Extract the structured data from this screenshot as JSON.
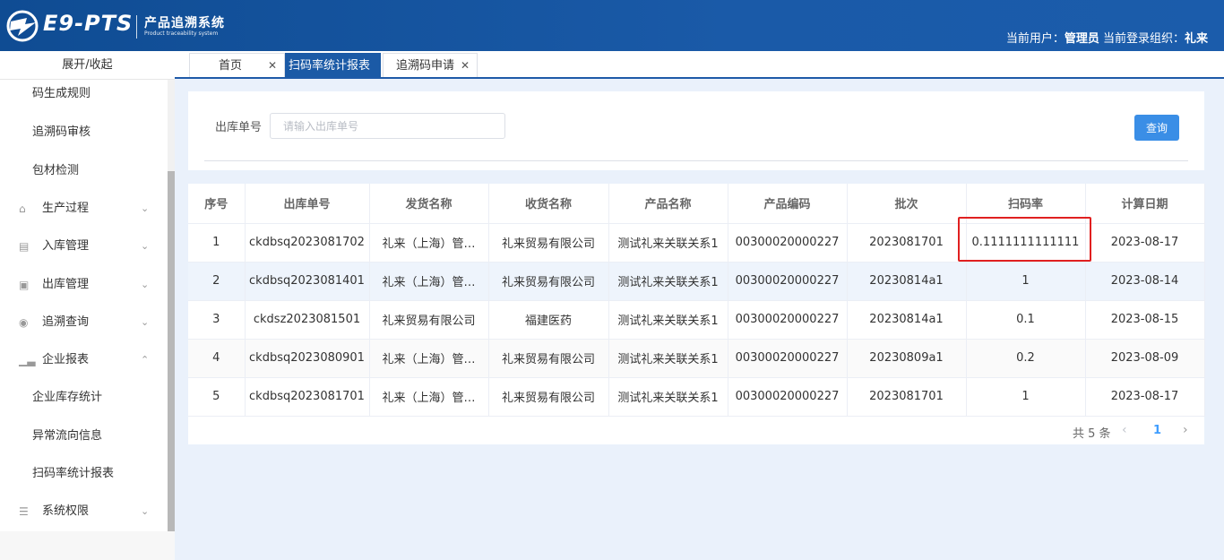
{
  "header": {
    "brand": "E9-PTS",
    "brand_cn": "产品追溯系统",
    "brand_en": "Product traceability system",
    "user_label": "当前用户：",
    "user_name": "管理员",
    "org_label": " 当前登录组织：",
    "org_name": "礼来"
  },
  "sidebar": {
    "toggle": "展开/收起",
    "items": [
      {
        "label": "码生成规则",
        "type": "sub"
      },
      {
        "label": "追溯码审核",
        "type": "sub"
      },
      {
        "label": "包材检测",
        "type": "sub"
      },
      {
        "label": "生产过程",
        "type": "top",
        "icon": "home-icon",
        "expanded": false
      },
      {
        "label": "入库管理",
        "type": "top",
        "icon": "inbound-icon",
        "expanded": false
      },
      {
        "label": "出库管理",
        "type": "top",
        "icon": "outbound-icon",
        "expanded": false
      },
      {
        "label": "追溯查询",
        "type": "top",
        "icon": "trace-icon",
        "expanded": false
      },
      {
        "label": "企业报表",
        "type": "top",
        "icon": "chart-icon",
        "expanded": true
      },
      {
        "label": "企业库存统计",
        "type": "sub"
      },
      {
        "label": "异常流向信息",
        "type": "sub"
      },
      {
        "label": "扫码率统计报表",
        "type": "sub"
      },
      {
        "label": "系统权限",
        "type": "top",
        "icon": "list-icon",
        "expanded": false
      }
    ]
  },
  "tabs": [
    {
      "label": "首页",
      "active": false
    },
    {
      "label": "扫码率统计报表",
      "active": true
    },
    {
      "label": "追溯码申请",
      "active": false
    }
  ],
  "search": {
    "label": "出库单号",
    "placeholder": "请输入出库单号",
    "value": "",
    "button": "查询"
  },
  "table": {
    "headers": [
      "序号",
      "出库单号",
      "发货名称",
      "收货名称",
      "产品名称",
      "产品编码",
      "批次",
      "扫码率",
      "计算日期"
    ],
    "rows": [
      [
        "1",
        "ckdbsq2023081702",
        "礼来（上海）管…",
        "礼来贸易有限公司",
        "测试礼来关联关系1",
        "00300020000227",
        "2023081701",
        "0.1111111111111",
        "2023-08-17"
      ],
      [
        "2",
        "ckdbsq2023081401",
        "礼来（上海）管…",
        "礼来贸易有限公司",
        "测试礼来关联关系1",
        "00300020000227",
        "20230814a1",
        "1",
        "2023-08-14"
      ],
      [
        "3",
        "ckdsz2023081501",
        "礼来贸易有限公司",
        "福建医药",
        "测试礼来关联关系1",
        "00300020000227",
        "20230814a1",
        "0.1",
        "2023-08-15"
      ],
      [
        "4",
        "ckdbsq2023080901",
        "礼来（上海）管…",
        "礼来贸易有限公司",
        "测试礼来关联关系1",
        "00300020000227",
        "20230809a1",
        "0.2",
        "2023-08-09"
      ],
      [
        "5",
        "ckdbsq2023081701",
        "礼来（上海）管…",
        "礼来贸易有限公司",
        "测试礼来关联关系1",
        "00300020000227",
        "2023081701",
        "1",
        "2023-08-17"
      ]
    ]
  },
  "pagination": {
    "total": "共 5 条",
    "current_page": "1"
  },
  "colors": {
    "header": "#1a5aa8",
    "accent": "#3a8ee6",
    "highlight": "#e02020"
  }
}
